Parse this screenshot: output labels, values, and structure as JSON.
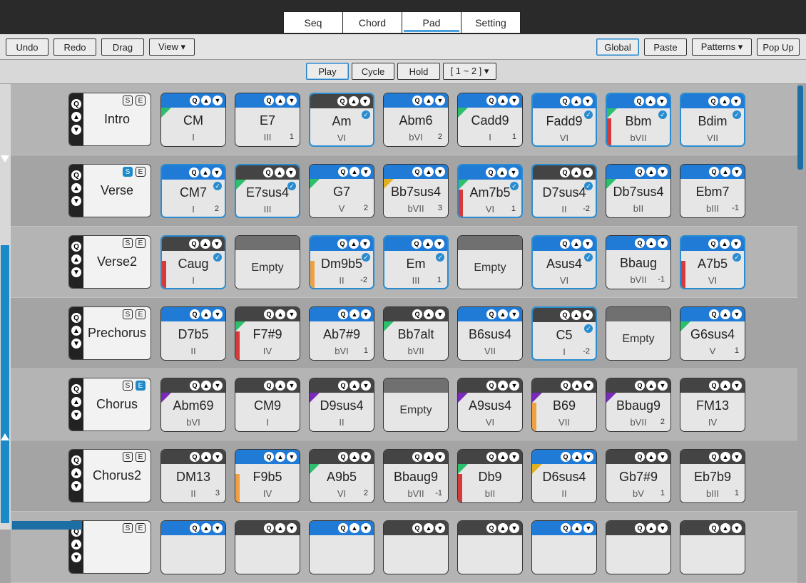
{
  "tabs": [
    {
      "label": "Seq",
      "active": false
    },
    {
      "label": "Chord",
      "active": false
    },
    {
      "label": "Pad",
      "active": true
    },
    {
      "label": "Setting",
      "active": false
    }
  ],
  "toolbar": {
    "undo": "Undo",
    "redo": "Redo",
    "drag": "Drag",
    "view": "View ▾",
    "global": "Global",
    "paste": "Paste",
    "patterns": "Patterns ▾",
    "popup": "Pop Up"
  },
  "playbar": {
    "play": "Play",
    "cycle": "Cycle",
    "hold": "Hold",
    "range": "[ 1 ~ 2 ] ▾"
  },
  "section_buttons": {
    "q": "Q",
    "s": "S",
    "e": "E"
  },
  "pad_controls": {
    "q": "Q",
    "up": "▲",
    "down": "▼",
    "check": "✓"
  },
  "empty_label": "Empty",
  "rows": [
    {
      "section": "Intro",
      "s_on": false,
      "e_on": false,
      "pads": [
        {
          "name": "CM",
          "deg": "I",
          "num": "",
          "hdr": "blue",
          "hl": false,
          "check": false,
          "flag": "green",
          "bar": ""
        },
        {
          "name": "E7",
          "deg": "III",
          "num": "1",
          "hdr": "blue",
          "hl": false,
          "check": false,
          "flag": "",
          "bar": ""
        },
        {
          "name": "Am",
          "deg": "VI",
          "num": "",
          "hdr": "dark",
          "hl": true,
          "check": true,
          "flag": "",
          "bar": ""
        },
        {
          "name": "Abm6",
          "deg": "bVI",
          "num": "2",
          "hdr": "blue",
          "hl": false,
          "check": false,
          "flag": "",
          "bar": ""
        },
        {
          "name": "Cadd9",
          "deg": "I",
          "num": "1",
          "hdr": "blue",
          "hl": false,
          "check": false,
          "flag": "green",
          "bar": ""
        },
        {
          "name": "Fadd9",
          "deg": "VI",
          "num": "",
          "hdr": "blue",
          "hl": true,
          "check": true,
          "flag": "",
          "bar": ""
        },
        {
          "name": "Bbm",
          "deg": "bVII",
          "num": "",
          "hdr": "blue",
          "hl": true,
          "check": true,
          "flag": "green",
          "bar": "#d63a3a"
        },
        {
          "name": "Bdim",
          "deg": "VII",
          "num": "",
          "hdr": "blue",
          "hl": true,
          "check": true,
          "flag": "",
          "bar": ""
        }
      ]
    },
    {
      "section": "Verse",
      "s_on": true,
      "e_on": false,
      "pads": [
        {
          "name": "CM7",
          "deg": "I",
          "num": "2",
          "hdr": "blue",
          "hl": true,
          "check": true,
          "flag": "",
          "bar": ""
        },
        {
          "name": "E7sus4",
          "deg": "III",
          "num": "",
          "hdr": "dark",
          "hl": true,
          "check": true,
          "flag": "green",
          "bar": ""
        },
        {
          "name": "G7",
          "deg": "V",
          "num": "2",
          "hdr": "blue",
          "hl": false,
          "check": false,
          "flag": "green",
          "bar": ""
        },
        {
          "name": "Bb7sus4",
          "deg": "bVII",
          "num": "3",
          "hdr": "blue",
          "hl": false,
          "check": false,
          "flag": "yellow",
          "bar": ""
        },
        {
          "name": "Am7b5",
          "deg": "VI",
          "num": "1",
          "hdr": "blue",
          "hl": true,
          "check": true,
          "flag": "green",
          "bar": "#d63a3a"
        },
        {
          "name": "D7sus4",
          "deg": "II",
          "num": "-2",
          "hdr": "dark",
          "hl": true,
          "check": true,
          "flag": "",
          "bar": ""
        },
        {
          "name": "Db7sus4",
          "deg": "bII",
          "num": "",
          "hdr": "blue",
          "hl": false,
          "check": false,
          "flag": "green",
          "bar": ""
        },
        {
          "name": "Ebm7",
          "deg": "bIII",
          "num": "-1",
          "hdr": "blue",
          "hl": false,
          "check": false,
          "flag": "",
          "bar": ""
        }
      ]
    },
    {
      "section": "Verse2",
      "s_on": false,
      "e_on": false,
      "pads": [
        {
          "name": "Caug",
          "deg": "I",
          "num": "",
          "hdr": "dark",
          "hl": true,
          "check": true,
          "flag": "",
          "bar": "#d63a3a"
        },
        {
          "empty": true
        },
        {
          "name": "Dm9b5",
          "deg": "II",
          "num": "-2",
          "hdr": "blue",
          "hl": true,
          "check": true,
          "flag": "",
          "bar": "#f0a040"
        },
        {
          "name": "Em",
          "deg": "III",
          "num": "1",
          "hdr": "blue",
          "hl": true,
          "check": true,
          "flag": "",
          "bar": ""
        },
        {
          "empty": true
        },
        {
          "name": "Asus4",
          "deg": "VI",
          "num": "",
          "hdr": "blue",
          "hl": true,
          "check": true,
          "flag": "",
          "bar": ""
        },
        {
          "name": "Bbaug",
          "deg": "bVII",
          "num": "-1",
          "hdr": "blue",
          "hl": false,
          "check": false,
          "flag": "",
          "bar": ""
        },
        {
          "name": "A7b5",
          "deg": "VI",
          "num": "",
          "hdr": "blue",
          "hl": true,
          "check": true,
          "flag": "",
          "bar": "#d63a3a"
        }
      ]
    },
    {
      "section": "Prechorus",
      "s_on": false,
      "e_on": false,
      "pads": [
        {
          "name": "D7b5",
          "deg": "II",
          "num": "",
          "hdr": "blue",
          "hl": false,
          "check": false,
          "flag": "",
          "bar": ""
        },
        {
          "name": "F7#9",
          "deg": "IV",
          "num": "",
          "hdr": "dark",
          "hl": false,
          "check": false,
          "flag": "green",
          "bar": "#d63a3a"
        },
        {
          "name": "Ab7#9",
          "deg": "bVI",
          "num": "1",
          "hdr": "blue",
          "hl": false,
          "check": false,
          "flag": "",
          "bar": ""
        },
        {
          "name": "Bb7alt",
          "deg": "bVII",
          "num": "",
          "hdr": "dark",
          "hl": false,
          "check": false,
          "flag": "green",
          "bar": ""
        },
        {
          "name": "B6sus4",
          "deg": "VII",
          "num": "",
          "hdr": "blue",
          "hl": false,
          "check": false,
          "flag": "",
          "bar": ""
        },
        {
          "name": "C5",
          "deg": "I",
          "num": "-2",
          "hdr": "dark",
          "hl": true,
          "check": true,
          "flag": "",
          "bar": ""
        },
        {
          "empty": true
        },
        {
          "name": "G6sus4",
          "deg": "V",
          "num": "1",
          "hdr": "blue",
          "hl": false,
          "check": false,
          "flag": "green",
          "bar": ""
        }
      ]
    },
    {
      "section": "Chorus",
      "s_on": false,
      "e_on": true,
      "pads": [
        {
          "name": "Abm69",
          "deg": "bVI",
          "num": "",
          "hdr": "dark",
          "hl": false,
          "check": false,
          "flag": "purple",
          "bar": ""
        },
        {
          "name": "CM9",
          "deg": "I",
          "num": "",
          "hdr": "dark",
          "hl": false,
          "check": false,
          "flag": "",
          "bar": ""
        },
        {
          "name": "D9sus4",
          "deg": "II",
          "num": "",
          "hdr": "dark",
          "hl": false,
          "check": false,
          "flag": "purple",
          "bar": ""
        },
        {
          "empty": true
        },
        {
          "name": "A9sus4",
          "deg": "VI",
          "num": "",
          "hdr": "dark",
          "hl": false,
          "check": false,
          "flag": "purple",
          "bar": ""
        },
        {
          "name": "B69",
          "deg": "VII",
          "num": "",
          "hdr": "dark",
          "hl": false,
          "check": false,
          "flag": "purple",
          "bar": "#f0a040"
        },
        {
          "name": "Bbaug9",
          "deg": "bVII",
          "num": "2",
          "hdr": "dark",
          "hl": false,
          "check": false,
          "flag": "purple",
          "bar": ""
        },
        {
          "name": "FM13",
          "deg": "IV",
          "num": "",
          "hdr": "dark",
          "hl": false,
          "check": false,
          "flag": "",
          "bar": ""
        }
      ]
    },
    {
      "section": "Chorus2",
      "s_on": false,
      "e_on": false,
      "pads": [
        {
          "name": "DM13",
          "deg": "II",
          "num": "3",
          "hdr": "dark",
          "hl": false,
          "check": false,
          "flag": "",
          "bar": ""
        },
        {
          "name": "F9b5",
          "deg": "IV",
          "num": "",
          "hdr": "blue",
          "hl": false,
          "check": false,
          "flag": "",
          "bar": "#f0a040"
        },
        {
          "name": "A9b5",
          "deg": "VI",
          "num": "2",
          "hdr": "dark",
          "hl": false,
          "check": false,
          "flag": "green",
          "bar": ""
        },
        {
          "name": "Bbaug9",
          "deg": "bVII",
          "num": "-1",
          "hdr": "dark",
          "hl": false,
          "check": false,
          "flag": "",
          "bar": ""
        },
        {
          "name": "Db9",
          "deg": "bII",
          "num": "",
          "hdr": "dark",
          "hl": false,
          "check": false,
          "flag": "green",
          "bar": "#d63a3a"
        },
        {
          "name": "D6sus4",
          "deg": "II",
          "num": "",
          "hdr": "blue",
          "hl": false,
          "check": false,
          "flag": "yellow",
          "bar": ""
        },
        {
          "name": "Gb7#9",
          "deg": "bV",
          "num": "1",
          "hdr": "dark",
          "hl": false,
          "check": false,
          "flag": "",
          "bar": ""
        },
        {
          "name": "Eb7b9",
          "deg": "bIII",
          "num": "1",
          "hdr": "dark",
          "hl": false,
          "check": false,
          "flag": "",
          "bar": ""
        }
      ]
    },
    {
      "section": "",
      "s_on": false,
      "e_on": false,
      "partial": true,
      "pads": [
        {
          "hdr": "blue"
        },
        {
          "hdr": "dark"
        },
        {
          "hdr": "blue"
        },
        {
          "hdr": "dark"
        },
        {
          "hdr": "dark"
        },
        {
          "hdr": "blue"
        },
        {
          "hdr": "dark"
        },
        {
          "hdr": "dark"
        }
      ]
    }
  ]
}
